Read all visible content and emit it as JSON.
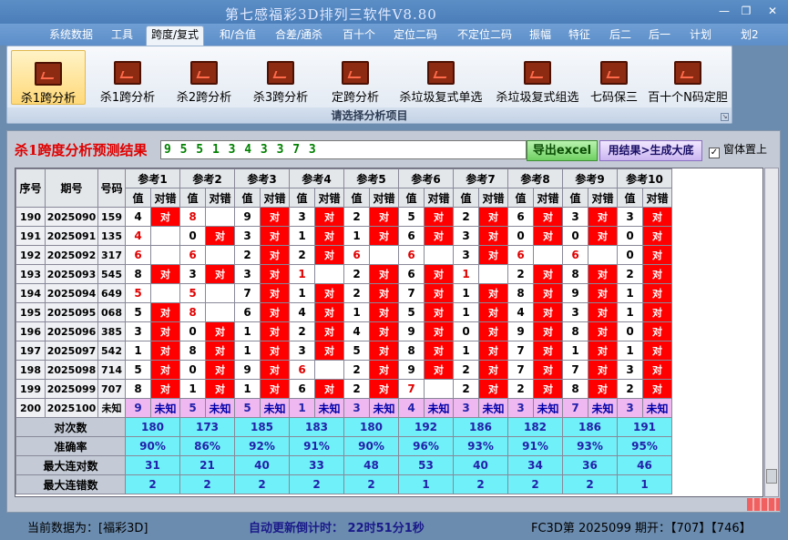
{
  "app": {
    "title": "第七感福彩3D排列三软件V8.80"
  },
  "menu": [
    "系统数据",
    "工具",
    "跨度/复式",
    "和/合值",
    "合差/通杀",
    "百十个",
    "定位二码",
    "不定位二码",
    "振幅",
    "特征",
    "后二",
    "后一",
    "计划",
    "划2"
  ],
  "menu_active": 2,
  "ribbon": {
    "buttons": [
      "杀1跨分析",
      "杀1跨分析",
      "杀2跨分析",
      "杀3跨分析",
      "定跨分析",
      "杀垃圾复式单选",
      "杀垃圾复式组选",
      "七码保三",
      "百十个N码定胆"
    ],
    "active": 0,
    "caption": "请选择分析项目"
  },
  "result": {
    "label": "杀1跨度分析预测结果",
    "value": "9 5 5 1 3 4 3 3 7 3",
    "export_label": "导出excel",
    "generate_label": "用结果>生成大底",
    "topmost_label": "窗体置上"
  },
  "grid": {
    "col_seq": "序号",
    "col_period": "期号",
    "col_number": "号码",
    "refs": [
      "参考1",
      "参考2",
      "参考3",
      "参考4",
      "参考5",
      "参考6",
      "参考7",
      "参考8",
      "参考9",
      "参考10"
    ],
    "sub_val": "值",
    "sub_check": "对错",
    "hit_text": "对",
    "rows": [
      {
        "seq": "190",
        "period": "2025090",
        "num": "159",
        "cells": [
          [
            "4",
            1
          ],
          [
            "8",
            0
          ],
          [
            "9",
            1
          ],
          [
            "3",
            1
          ],
          [
            "2",
            1
          ],
          [
            "5",
            1
          ],
          [
            "2",
            1
          ],
          [
            "6",
            1
          ],
          [
            "3",
            1
          ],
          [
            "3",
            1
          ]
        ]
      },
      {
        "seq": "191",
        "period": "2025091",
        "num": "135",
        "cells": [
          [
            "4",
            0
          ],
          [
            "0",
            1
          ],
          [
            "3",
            1
          ],
          [
            "1",
            1
          ],
          [
            "1",
            1
          ],
          [
            "6",
            1
          ],
          [
            "3",
            1
          ],
          [
            "0",
            1
          ],
          [
            "0",
            1
          ],
          [
            "0",
            1
          ]
        ]
      },
      {
        "seq": "192",
        "period": "2025092",
        "num": "317",
        "cells": [
          [
            "6",
            0
          ],
          [
            "6",
            0
          ],
          [
            "2",
            1
          ],
          [
            "2",
            1
          ],
          [
            "6",
            0
          ],
          [
            "6",
            0
          ],
          [
            "3",
            1
          ],
          [
            "6",
            0
          ],
          [
            "6",
            0
          ],
          [
            "0",
            1
          ]
        ]
      },
      {
        "seq": "193",
        "period": "2025093",
        "num": "545",
        "cells": [
          [
            "8",
            1
          ],
          [
            "3",
            1
          ],
          [
            "3",
            1
          ],
          [
            "1",
            0
          ],
          [
            "2",
            1
          ],
          [
            "6",
            1
          ],
          [
            "1",
            0
          ],
          [
            "2",
            1
          ],
          [
            "8",
            1
          ],
          [
            "2",
            1
          ]
        ]
      },
      {
        "seq": "194",
        "period": "2025094",
        "num": "649",
        "cells": [
          [
            "5",
            0
          ],
          [
            "5",
            0
          ],
          [
            "7",
            1
          ],
          [
            "1",
            1
          ],
          [
            "2",
            1
          ],
          [
            "7",
            1
          ],
          [
            "1",
            1
          ],
          [
            "8",
            1
          ],
          [
            "9",
            1
          ],
          [
            "1",
            1
          ]
        ]
      },
      {
        "seq": "195",
        "period": "2025095",
        "num": "068",
        "cells": [
          [
            "5",
            1
          ],
          [
            "8",
            0
          ],
          [
            "6",
            1
          ],
          [
            "4",
            1
          ],
          [
            "1",
            1
          ],
          [
            "5",
            1
          ],
          [
            "1",
            1
          ],
          [
            "4",
            1
          ],
          [
            "3",
            1
          ],
          [
            "1",
            1
          ]
        ]
      },
      {
        "seq": "196",
        "period": "2025096",
        "num": "385",
        "cells": [
          [
            "3",
            1
          ],
          [
            "0",
            1
          ],
          [
            "1",
            1
          ],
          [
            "2",
            1
          ],
          [
            "4",
            1
          ],
          [
            "9",
            1
          ],
          [
            "0",
            1
          ],
          [
            "9",
            1
          ],
          [
            "8",
            1
          ],
          [
            "0",
            1
          ]
        ]
      },
      {
        "seq": "197",
        "period": "2025097",
        "num": "542",
        "cells": [
          [
            "1",
            1
          ],
          [
            "8",
            1
          ],
          [
            "1",
            1
          ],
          [
            "3",
            1
          ],
          [
            "5",
            1
          ],
          [
            "8",
            1
          ],
          [
            "1",
            1
          ],
          [
            "7",
            1
          ],
          [
            "1",
            1
          ],
          [
            "1",
            1
          ]
        ]
      },
      {
        "seq": "198",
        "period": "2025098",
        "num": "714",
        "cells": [
          [
            "5",
            1
          ],
          [
            "0",
            1
          ],
          [
            "9",
            1
          ],
          [
            "6",
            0
          ],
          [
            "2",
            1
          ],
          [
            "9",
            1
          ],
          [
            "2",
            1
          ],
          [
            "7",
            1
          ],
          [
            "7",
            1
          ],
          [
            "3",
            1
          ]
        ]
      },
      {
        "seq": "199",
        "period": "2025099",
        "num": "707",
        "cells": [
          [
            "8",
            1
          ],
          [
            "1",
            1
          ],
          [
            "1",
            1
          ],
          [
            "6",
            1
          ],
          [
            "2",
            1
          ],
          [
            "7",
            0
          ],
          [
            "2",
            1
          ],
          [
            "2",
            1
          ],
          [
            "8",
            1
          ],
          [
            "2",
            1
          ]
        ]
      }
    ],
    "unknown_row": {
      "seq": "200",
      "period": "2025100",
      "num": "未知",
      "values": [
        "9",
        "5",
        "5",
        "1",
        "3",
        "4",
        "3",
        "3",
        "7",
        "3"
      ],
      "text": "未知"
    },
    "stats": [
      {
        "label": "对次数",
        "values": [
          "180",
          "173",
          "185",
          "183",
          "180",
          "192",
          "186",
          "182",
          "186",
          "191"
        ]
      },
      {
        "label": "准确率",
        "values": [
          "90%",
          "86%",
          "92%",
          "91%",
          "90%",
          "96%",
          "93%",
          "91%",
          "93%",
          "95%"
        ]
      },
      {
        "label": "最大连对数",
        "values": [
          "31",
          "21",
          "40",
          "33",
          "48",
          "53",
          "40",
          "34",
          "36",
          "46"
        ]
      },
      {
        "label": "最大连错数",
        "values": [
          "2",
          "2",
          "2",
          "2",
          "2",
          "1",
          "2",
          "2",
          "2",
          "1"
        ]
      }
    ]
  },
  "status": {
    "current_data": "当前数据为：[福彩3D]",
    "countdown": "自动更新倒计时：  22时51分1秒",
    "issue": "FC3D第 2025099 期开：【707】【746】"
  },
  "colors": {
    "hit": "#ff0000",
    "stat": "#70f0f8",
    "unknown": "#f0b8f0",
    "accent_red": "#e00000"
  }
}
